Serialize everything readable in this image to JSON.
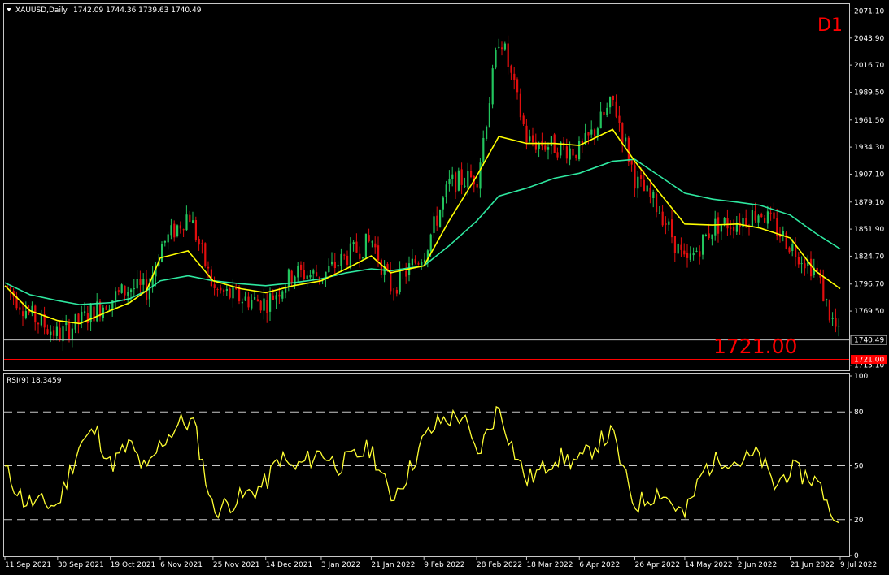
{
  "header": {
    "symbol": "XAUUSD,Daily",
    "ohlc": "1742.09 1744.36 1739.63 1740.49",
    "timeframe_badge": "D1",
    "annotation": "1721.00"
  },
  "price_pane": {
    "current_price_label": "1740.49",
    "support_label": "1721.00",
    "y_ticks": [
      "2071.10",
      "2043.90",
      "2016.70",
      "1989.50",
      "1961.50",
      "1934.30",
      "1907.10",
      "1879.10",
      "1851.90",
      "1824.70",
      "1796.70",
      "1769.50",
      "1715.10"
    ]
  },
  "rsi_pane": {
    "label": "RSI(9) 18.3459",
    "y_ticks": [
      "100",
      "80",
      "50",
      "20",
      "0"
    ]
  },
  "x_axis": {
    "ticks": [
      "11 Sep 2021",
      "30 Sep 2021",
      "19 Oct 2021",
      "6 Nov 2021",
      "25 Nov 2021",
      "14 Dec 2021",
      "3 Jan 2022",
      "21 Jan 2022",
      "9 Feb 2022",
      "28 Feb 2022",
      "18 Mar 2022",
      "6 Apr 2022",
      "26 Apr 2022",
      "14 May 2022",
      "2 Jun 2022",
      "21 Jun 2022",
      "9 Jul 2022"
    ]
  },
  "colors": {
    "bull": "#22c55e",
    "bear": "#e10e0e",
    "ma_fast": "#ffff00",
    "ma_slow": "#2ee8a0",
    "rsi": "#ffff33",
    "support": "#ff0000",
    "annotation": "#ff0000"
  },
  "chart_data": {
    "type": "candlestick",
    "symbol": "XAUUSD",
    "timeframe": "Daily",
    "ylim": [
      1710,
      2078
    ],
    "horizontal_lines": [
      1740.49,
      1721.0
    ],
    "price_path": [
      [
        "11 Sep 2021",
        1795
      ],
      [
        "20 Sep 2021",
        1765
      ],
      [
        "30 Sep 2021",
        1745
      ],
      [
        "8 Oct 2021",
        1760
      ],
      [
        "19 Oct 2021",
        1782
      ],
      [
        "26 Oct 2021",
        1793
      ],
      [
        "1 Nov 2021",
        1790
      ],
      [
        "6 Nov 2021",
        1835
      ],
      [
        "16 Nov 2021",
        1868
      ],
      [
        "25 Nov 2021",
        1790
      ],
      [
        "5 Dec 2021",
        1782
      ],
      [
        "14 Dec 2021",
        1778
      ],
      [
        "24 Dec 2021",
        1808
      ],
      [
        "3 Jan 2022",
        1805
      ],
      [
        "12 Jan 2022",
        1825
      ],
      [
        "21 Jan 2022",
        1840
      ],
      [
        "28 Jan 2022",
        1792
      ],
      [
        "9 Feb 2022",
        1830
      ],
      [
        "18 Feb 2022",
        1898
      ],
      [
        "28 Feb 2022",
        1905
      ],
      [
        "8 Mar 2022",
        2050
      ],
      [
        "18 Mar 2022",
        1940
      ],
      [
        "28 Mar 2022",
        1935
      ],
      [
        "6 Apr 2022",
        1930
      ],
      [
        "18 Apr 2022",
        1980
      ],
      [
        "26 Apr 2022",
        1900
      ],
      [
        "5 May 2022",
        1870
      ],
      [
        "14 May 2022",
        1815
      ],
      [
        "24 May 2022",
        1855
      ],
      [
        "2 Jun 2022",
        1860
      ],
      [
        "10 Jun 2022",
        1870
      ],
      [
        "21 Jun 2022",
        1835
      ],
      [
        "30 Jun 2022",
        1810
      ],
      [
        "5 Jul 2022",
        1765
      ],
      [
        "9 Jul 2022",
        1740
      ]
    ],
    "ma_fast": [
      [
        "11 Sep 2021",
        1795
      ],
      [
        "20 Sep 2021",
        1770
      ],
      [
        "30 Sep 2021",
        1760
      ],
      [
        "8 Oct 2021",
        1757
      ],
      [
        "19 Oct 2021",
        1770
      ],
      [
        "26 Oct 2021",
        1778
      ],
      [
        "1 Nov 2021",
        1790
      ],
      [
        "6 Nov 2021",
        1823
      ],
      [
        "16 Nov 2021",
        1830
      ],
      [
        "25 Nov 2021",
        1800
      ],
      [
        "5 Dec 2021",
        1792
      ],
      [
        "14 Dec 2021",
        1788
      ],
      [
        "24 Dec 2021",
        1795
      ],
      [
        "3 Jan 2022",
        1800
      ],
      [
        "12 Jan 2022",
        1812
      ],
      [
        "21 Jan 2022",
        1825
      ],
      [
        "28 Jan 2022",
        1808
      ],
      [
        "9 Feb 2022",
        1815
      ],
      [
        "18 Feb 2022",
        1860
      ],
      [
        "28 Feb 2022",
        1905
      ],
      [
        "8 Mar 2022",
        1945
      ],
      [
        "18 Mar 2022",
        1938
      ],
      [
        "28 Mar 2022",
        1938
      ],
      [
        "6 Apr 2022",
        1936
      ],
      [
        "18 Apr 2022",
        1952
      ],
      [
        "26 Apr 2022",
        1920
      ],
      [
        "5 May 2022",
        1888
      ],
      [
        "14 May 2022",
        1857
      ],
      [
        "24 May 2022",
        1856
      ],
      [
        "2 Jun 2022",
        1857
      ],
      [
        "10 Jun 2022",
        1853
      ],
      [
        "21 Jun 2022",
        1843
      ],
      [
        "30 Jun 2022",
        1810
      ],
      [
        "9 Jul 2022",
        1792
      ]
    ],
    "ma_slow": [
      [
        "11 Sep 2021",
        1798
      ],
      [
        "20 Sep 2021",
        1786
      ],
      [
        "30 Sep 2021",
        1780
      ],
      [
        "8 Oct 2021",
        1776
      ],
      [
        "19 Oct 2021",
        1778
      ],
      [
        "26 Oct 2021",
        1782
      ],
      [
        "1 Nov 2021",
        1790
      ],
      [
        "6 Nov 2021",
        1800
      ],
      [
        "16 Nov 2021",
        1805
      ],
      [
        "25 Nov 2021",
        1800
      ],
      [
        "5 Dec 2021",
        1797
      ],
      [
        "14 Dec 2021",
        1795
      ],
      [
        "24 Dec 2021",
        1798
      ],
      [
        "3 Jan 2022",
        1802
      ],
      [
        "12 Jan 2022",
        1808
      ],
      [
        "21 Jan 2022",
        1812
      ],
      [
        "28 Jan 2022",
        1810
      ],
      [
        "9 Feb 2022",
        1815
      ],
      [
        "18 Feb 2022",
        1835
      ],
      [
        "28 Feb 2022",
        1860
      ],
      [
        "8 Mar 2022",
        1885
      ],
      [
        "18 Mar 2022",
        1893
      ],
      [
        "28 Mar 2022",
        1903
      ],
      [
        "6 Apr 2022",
        1908
      ],
      [
        "18 Apr 2022",
        1920
      ],
      [
        "26 Apr 2022",
        1922
      ],
      [
        "5 May 2022",
        1905
      ],
      [
        "14 May 2022",
        1888
      ],
      [
        "24 May 2022",
        1882
      ],
      [
        "2 Jun 2022",
        1879
      ],
      [
        "10 Jun 2022",
        1876
      ],
      [
        "21 Jun 2022",
        1866
      ],
      [
        "30 Jun 2022",
        1848
      ],
      [
        "9 Jul 2022",
        1832
      ]
    ],
    "rsi": {
      "period": 9,
      "last_value": 18.3459,
      "levels": [
        20,
        50,
        80
      ],
      "ylim": [
        0,
        100
      ],
      "values": [
        [
          "11 Sep 2021",
          48
        ],
        [
          "18 Sep 2021",
          30
        ],
        [
          "30 Sep 2021",
          28
        ],
        [
          "8 Oct 2021",
          62
        ],
        [
          "14 Oct 2021",
          70
        ],
        [
          "19 Oct 2021",
          50
        ],
        [
          "26 Oct 2021",
          62
        ],
        [
          "1 Nov 2021",
          46
        ],
        [
          "6 Nov 2021",
          62
        ],
        [
          "13 Nov 2021",
          74
        ],
        [
          "18 Nov 2021",
          74
        ],
        [
          "25 Nov 2021",
          25
        ],
        [
          "5 Dec 2021",
          32
        ],
        [
          "14 Dec 2021",
          40
        ],
        [
          "19 Dec 2021",
          55
        ],
        [
          "24 Dec 2021",
          48
        ],
        [
          "3 Jan 2022",
          58
        ],
        [
          "9 Jan 2022",
          50
        ],
        [
          "15 Jan 2022",
          55
        ],
        [
          "21 Jan 2022",
          60
        ],
        [
          "28 Jan 2022",
          32
        ],
        [
          "3 Feb 2022",
          45
        ],
        [
          "9 Feb 2022",
          65
        ],
        [
          "15 Feb 2022",
          75
        ],
        [
          "23 Feb 2022",
          78
        ],
        [
          "28 Feb 2022",
          55
        ],
        [
          "8 Mar 2022",
          83
        ],
        [
          "13 Mar 2022",
          60
        ],
        [
          "18 Mar 2022",
          42
        ],
        [
          "24 Mar 2022",
          48
        ],
        [
          "28 Mar 2022",
          55
        ],
        [
          "6 Apr 2022",
          52
        ],
        [
          "12 Apr 2022",
          62
        ],
        [
          "18 Apr 2022",
          68
        ],
        [
          "22 Apr 2022",
          46
        ],
        [
          "26 Apr 2022",
          28
        ],
        [
          "5 May 2022",
          36
        ],
        [
          "14 May 2022",
          22
        ],
        [
          "21 May 2022",
          48
        ],
        [
          "28 May 2022",
          55
        ],
        [
          "2 Jun 2022",
          52
        ],
        [
          "10 Jun 2022",
          56
        ],
        [
          "15 Jun 2022",
          38
        ],
        [
          "21 Jun 2022",
          48
        ],
        [
          "30 Jun 2022",
          42
        ],
        [
          "5 Jul 2022",
          30
        ],
        [
          "7 Jul 2022",
          12
        ],
        [
          "9 Jul 2022",
          18.3
        ]
      ]
    }
  }
}
